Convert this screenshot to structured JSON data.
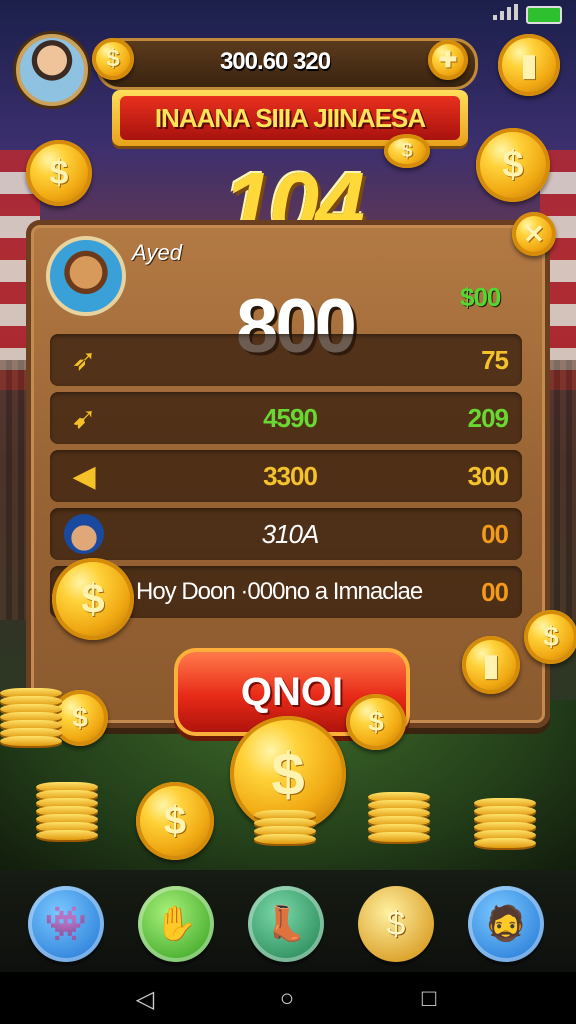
{
  "top_bar": {
    "coin_balance": "300.60 320",
    "coin_symbol": "$",
    "plus_symbol": "✚"
  },
  "banner": {
    "title": "INAANA SIIIA JIINAESA"
  },
  "big_number": "104",
  "panel": {
    "player_name": "Ayed",
    "score": "800",
    "close_symbol": "✕",
    "bonus_value": "$00",
    "rows": [
      {
        "mid": "",
        "right": "75",
        "mid_color": "#ffffff",
        "right_color": "#f4c22a"
      },
      {
        "mid": "4590",
        "right": "209",
        "mid_color": "#6ad832",
        "right_color": "#6ad832"
      },
      {
        "mid": "3300",
        "right": "300",
        "mid_color": "#f4c22a",
        "right_color": "#f4c22a"
      },
      {
        "mid": "310A",
        "right": "00",
        "mid_color": "#ffffff",
        "right_color": "#f29a1a"
      },
      {
        "long": "Hoy Doon ·000no a Imnaclae",
        "right": "00",
        "right_color": "#f29a1a"
      }
    ]
  },
  "action_button": {
    "label": "QNOI"
  },
  "coin_glyph": "$",
  "bottom_nav": [
    {
      "icon": "monster-icon",
      "color": "#2a8ee0"
    },
    {
      "icon": "hand-icon",
      "color": "#4bb82a"
    },
    {
      "icon": "boot-icon",
      "color": "#2a9a5a"
    },
    {
      "icon": "coin-stack-icon",
      "color": "#e0a018"
    },
    {
      "icon": "character-icon",
      "color": "#2a8ee0"
    }
  ],
  "system_nav": {
    "back": "◁",
    "home": "○",
    "recents": "□"
  }
}
